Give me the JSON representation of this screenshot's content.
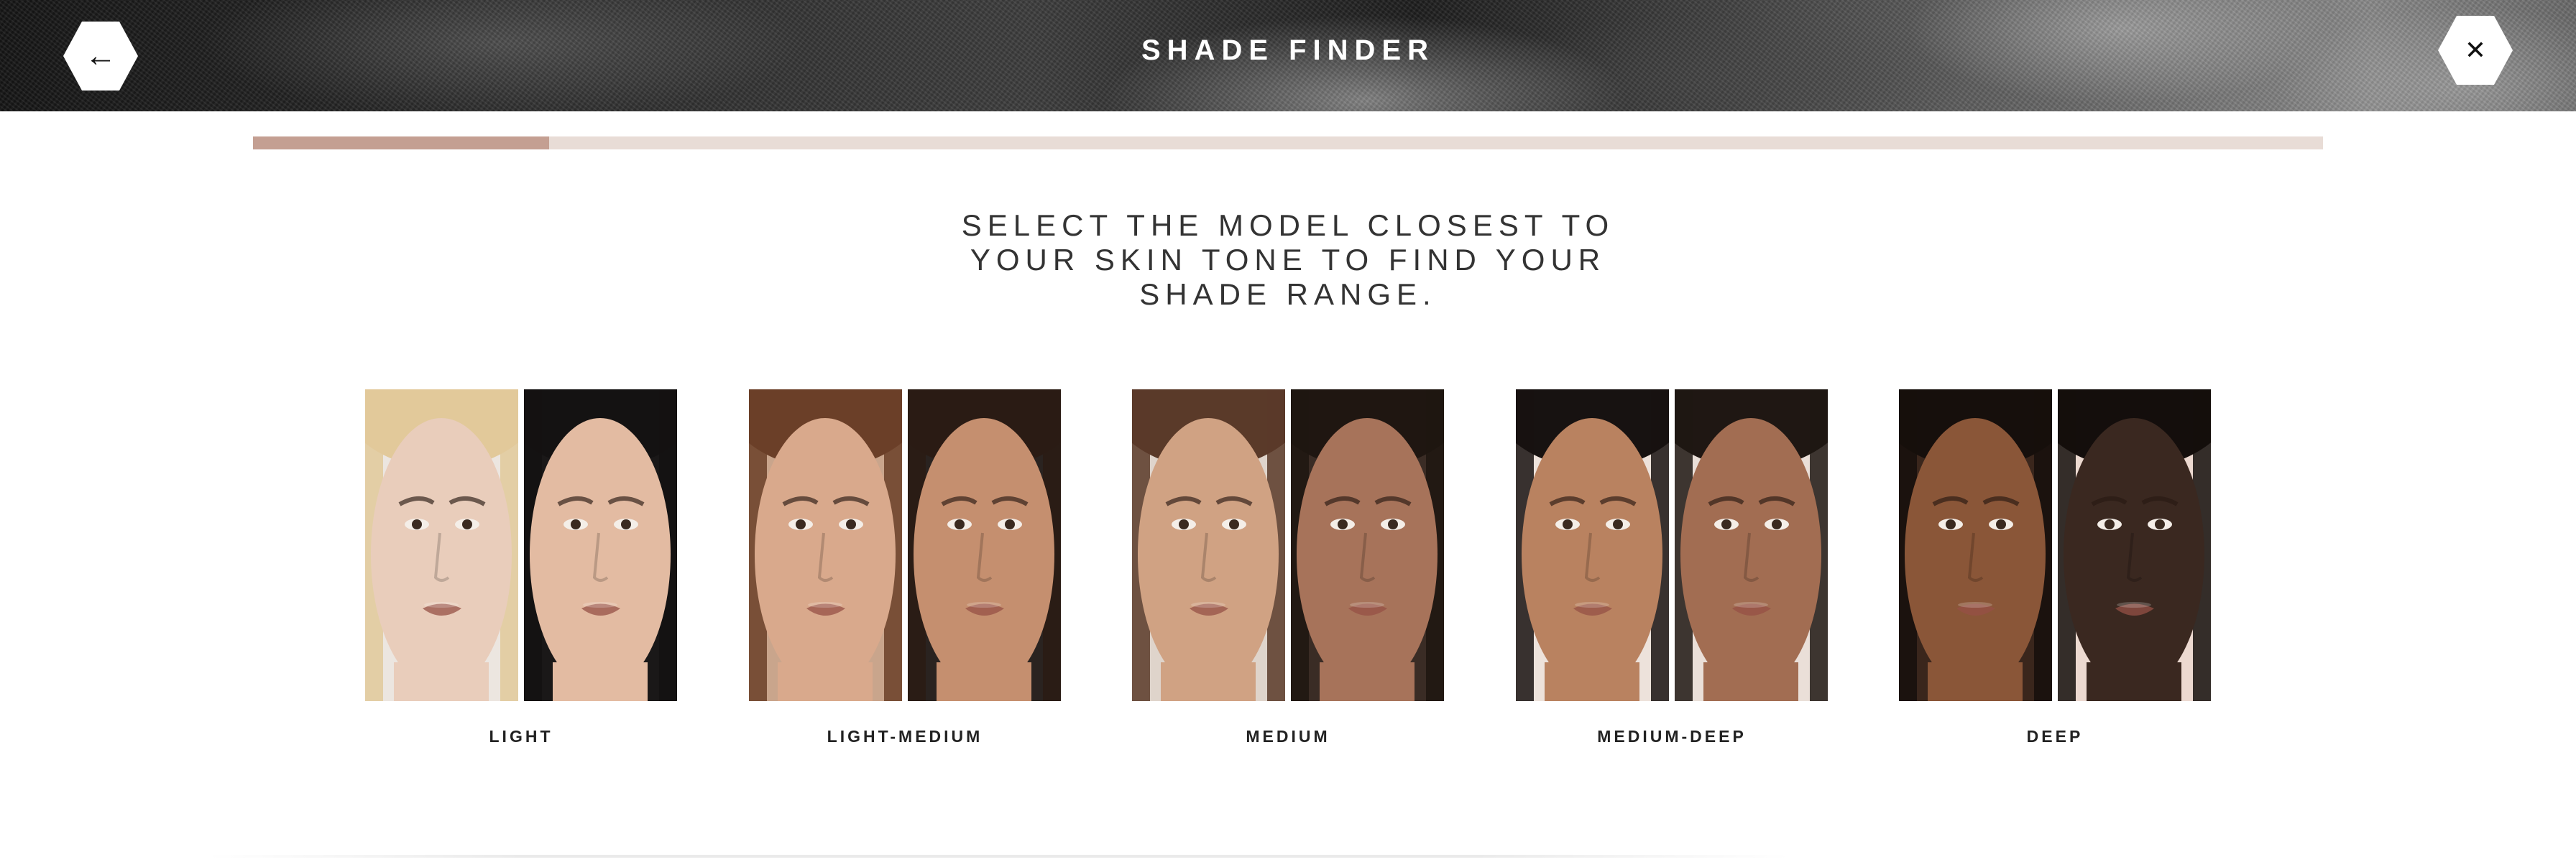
{
  "header": {
    "title": "SHADE FINDER",
    "back_icon": "arrow-left-icon",
    "close_icon": "close-icon",
    "back_glyph": "←",
    "close_glyph": "✕"
  },
  "progress": {
    "fraction": 0.143,
    "fill_color": "#c49f92",
    "track_color": "#e8dcd6"
  },
  "heading": "SELECT THE MODEL CLOSEST TO YOUR SKIN TONE TO FIND YOUR SHADE RANGE.",
  "options": [
    {
      "label": "LIGHT",
      "skin_tones": [
        "#e9cdbb",
        "#e3bba2"
      ],
      "hair_colors": [
        "#e2c99a",
        "#141212"
      ],
      "bg_colors": [
        "#ece6e0",
        "#1a1818"
      ]
    },
    {
      "label": "LIGHT-MEDIUM",
      "skin_tones": [
        "#d9a98c",
        "#c58f6f"
      ],
      "hair_colors": [
        "#6b3f28",
        "#2a1b14"
      ],
      "bg_colors": [
        "#c9a58c",
        "#2a2320"
      ]
    },
    {
      "label": "MEDIUM",
      "skin_tones": [
        "#d0a283",
        "#a7735a"
      ],
      "hair_colors": [
        "#5a3a29",
        "#1f1611"
      ],
      "bg_colors": [
        "#dfd4cb",
        "#3a2c25"
      ]
    },
    {
      "label": "MEDIUM-DEEP",
      "skin_tones": [
        "#b98260",
        "#a26d52"
      ],
      "hair_colors": [
        "#171211",
        "#1f1713"
      ],
      "bg_colors": [
        "#ede2db",
        "#eadfd8"
      ]
    },
    {
      "label": "DEEP",
      "skin_tones": [
        "#8a5638",
        "#3a2820"
      ],
      "hair_colors": [
        "#160f0c",
        "#140e0c"
      ],
      "bg_colors": [
        "#3a261c",
        "#ecd9d0"
      ]
    }
  ]
}
